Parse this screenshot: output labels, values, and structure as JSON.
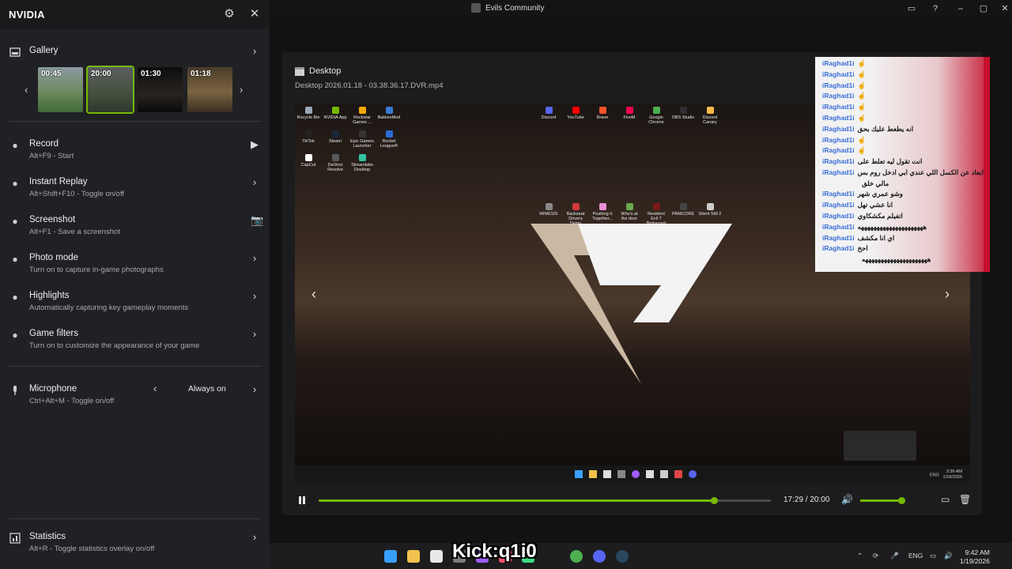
{
  "window": {
    "title": "Evils Community",
    "buttons": [
      "restore-icon",
      "help-icon",
      "minimize",
      "maximize",
      "close"
    ]
  },
  "panel": {
    "brand": "NVIDIA",
    "gallery": {
      "label": "Gallery",
      "thumbnails": [
        {
          "time": "00:45",
          "selected": false
        },
        {
          "time": "20:00",
          "selected": true
        },
        {
          "time": "01:30",
          "selected": false
        },
        {
          "time": "01:18",
          "selected": false
        }
      ]
    },
    "items": [
      {
        "label": "Record",
        "sub": "Alt+F9 - Start",
        "icon": "record-icon",
        "action": "play-icon"
      },
      {
        "label": "Instant Replay",
        "sub": "Alt+Shift+F10 - Toggle on/off",
        "icon": "replay-icon",
        "action": "chevron-right-icon"
      },
      {
        "label": "Screenshot",
        "sub": "Alt+F1 - Save a screenshot",
        "icon": "screenshot-icon",
        "action": "camera-icon"
      },
      {
        "label": "Photo mode",
        "sub": "Turn on to capture in-game photographs",
        "icon": "camera-icon",
        "action": "chevron-right-icon"
      },
      {
        "label": "Highlights",
        "sub": "Automatically capturing key gameplay moments",
        "icon": "highlights-icon",
        "action": "chevron-right-icon"
      },
      {
        "label": "Game filters",
        "sub": "Turn on to customize the appearance of your game",
        "icon": "filters-icon",
        "action": "chevron-right-icon"
      }
    ],
    "microphone": {
      "label": "Microphone",
      "sub": "Ctrl+Alt+M - Toggle on/off",
      "value": "Always on"
    },
    "statistics": {
      "label": "Statistics",
      "sub": "Alt+R - Toggle statistics overlay on/off"
    }
  },
  "viewer": {
    "title": "Desktop",
    "filename": "Desktop 2026.01.18 - 03.38.36.17.DVR.mp4",
    "time_label": "17:29 / 20:00",
    "progress": 0.874,
    "volume": 0.95
  },
  "screenshot_desktop": {
    "icons": [
      {
        "label": "Recycle Bin",
        "color": "#9aa7b5"
      },
      {
        "label": "NVIDIA App",
        "color": "#76b900"
      },
      {
        "label": "Rockstar Games ...",
        "color": "#f2a900"
      },
      {
        "label": "BakkesMod",
        "color": "#3a7bd5"
      },
      {
        "label": "TikTok",
        "color": "#222222"
      },
      {
        "label": "Steam",
        "color": "#1b2838"
      },
      {
        "label": "Epic Games Launcher",
        "color": "#333333"
      },
      {
        "label": "Rocket League®",
        "color": "#2a6ad8"
      },
      {
        "label": "CapCut",
        "color": "#ffffff"
      },
      {
        "label": "DaVinci Resolve",
        "color": "#5a5a5a"
      },
      {
        "label": "Streamlabs Desktop",
        "color": "#31c3a2"
      },
      {
        "label": "Discord",
        "color": "#5865f2"
      },
      {
        "label": "YouTube",
        "color": "#ff0000"
      },
      {
        "label": "Brave",
        "color": "#fb542b"
      },
      {
        "label": "FiveM",
        "color": "#f40552"
      },
      {
        "label": "Google Chrome",
        "color": "#4caf50"
      },
      {
        "label": "OBS Studio",
        "color": "#302e31"
      },
      {
        "label": "Discord Canary",
        "color": "#fbb848"
      },
      {
        "label": "MIMESIS",
        "color": "#888888"
      },
      {
        "label": "Backseat Drivers Demo",
        "color": "#d23b3b"
      },
      {
        "label": "Pushing It Together...",
        "color": "#e98fd3"
      },
      {
        "label": "Who's at the door",
        "color": "#6aa84f"
      },
      {
        "label": "Resident Evil 7 Biohazard",
        "color": "#7a1a1a"
      },
      {
        "label": "PANICORE",
        "color": "#444444"
      },
      {
        "label": "Silent Still 2",
        "color": "#cccccc"
      }
    ],
    "tray_time": "3:36 AM",
    "tray_date": "1/18/2026",
    "tray_lang": "ENG"
  },
  "chat": {
    "lines": [
      {
        "name": "iRaghad1i",
        "msg": "☝"
      },
      {
        "name": "iRaghad1i",
        "msg": "☝"
      },
      {
        "name": "iRaghad1i",
        "msg": "☝"
      },
      {
        "name": "iRaghad1i",
        "msg": "☝"
      },
      {
        "name": "iRaghad1i",
        "msg": "☝"
      },
      {
        "name": "iRaghad1i",
        "msg": "☝"
      },
      {
        "name": "iRaghad1i",
        "msg": "انه يطعط عليك بحق"
      },
      {
        "name": "iRaghad1i",
        "msg": "☝"
      },
      {
        "name": "iRaghad1i",
        "msg": "☝"
      },
      {
        "name": "iRaghad1i",
        "msg": "انت تقول ليه تعلط على"
      },
      {
        "name": "iRaghad1i",
        "msg": "ابعاد عن الكسل اللي عندي ابي ادخل روم بس"
      },
      {
        "name": "",
        "msg": "مالي خلق"
      },
      {
        "name": "iRaghad1i",
        "msg": "وشو عمري شهر"
      },
      {
        "name": "iRaghad1i",
        "msg": "انا عشي تهل"
      },
      {
        "name": "iRaghad1i",
        "msg": "اتفيلم مكشكاوي"
      },
      {
        "name": "iRaghad1i",
        "msg": "هههههههههههههههههههههه"
      },
      {
        "name": "iRaghad1i",
        "msg": "اي انا مكشف"
      },
      {
        "name": "iRaghad1i",
        "msg": "احخ"
      },
      {
        "name": "",
        "msg": "هههههههههههههههههههههه"
      }
    ]
  },
  "taskbar": {
    "overlay_text": "Kick:q1i0",
    "lang": "ENG",
    "time": "9:42 AM",
    "date": "1/19/2026",
    "apps": [
      {
        "name": "start",
        "color": "#3aa0ff"
      },
      {
        "name": "file-explorer",
        "color": "#f2c14e"
      },
      {
        "name": "store",
        "color": "#e9e9e9"
      },
      {
        "name": "app-4",
        "color": "#7c7c7c"
      },
      {
        "name": "app-5",
        "color": "#a05cff"
      },
      {
        "name": "app-6",
        "color": "#ff4d6d"
      },
      {
        "name": "app-7",
        "color": "#3ddc84"
      },
      {
        "name": "chrome",
        "color": "#4caf50"
      },
      {
        "name": "discord",
        "color": "#5865f2"
      },
      {
        "name": "steam",
        "color": "#2a475e"
      }
    ]
  }
}
